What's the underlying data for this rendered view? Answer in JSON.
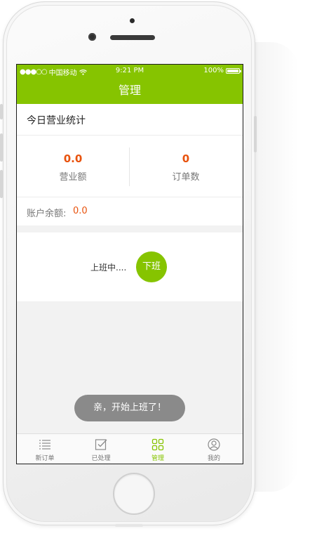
{
  "status_bar": {
    "signal": "●●●○○",
    "carrier": "中国移动",
    "wifi_icon": "wifi-icon",
    "time": "9:21 PM",
    "battery": "100%"
  },
  "nav": {
    "title": "管理"
  },
  "section": {
    "title": "今日营业统计"
  },
  "stats": [
    {
      "value": "0.0",
      "label": "营业额"
    },
    {
      "value": "0",
      "label": "订单数"
    }
  ],
  "balance": {
    "label": "账户余额:",
    "value": "0.0"
  },
  "work": {
    "status_text": "上班中....",
    "button_label": "下班"
  },
  "toast": {
    "message": "亲，开始上班了！"
  },
  "tabs": [
    {
      "label": "新订单",
      "icon": "list-icon",
      "active": false
    },
    {
      "label": "已处理",
      "icon": "checkbox-icon",
      "active": false
    },
    {
      "label": "管理",
      "icon": "grid-icon",
      "active": true
    },
    {
      "label": "我的",
      "icon": "user-icon",
      "active": false
    }
  ],
  "colors": {
    "accent": "#86c400",
    "highlight": "#e8530e"
  }
}
